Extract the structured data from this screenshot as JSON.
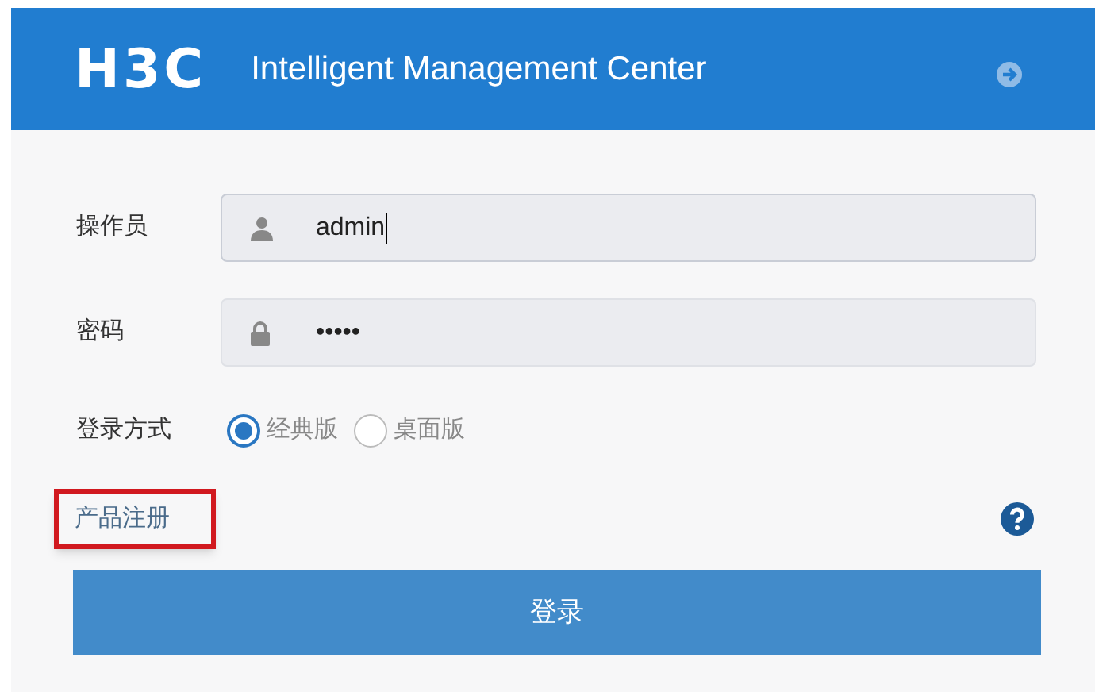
{
  "header": {
    "logo": "H3C",
    "title": "Intelligent Management Center"
  },
  "fields": [
    {
      "kind": "user",
      "label": "操作员",
      "value": "admin",
      "focused": true
    },
    {
      "kind": "lock",
      "label": "密码",
      "value": "•••••",
      "focused": false
    }
  ],
  "login_mode": {
    "label": "登录方式",
    "options": [
      {
        "label": "经典版",
        "selected": true
      },
      {
        "label": "桌面版",
        "selected": false
      }
    ]
  },
  "register_link": {
    "text": "产品注册",
    "highlighted": true
  },
  "login_button": "登录"
}
